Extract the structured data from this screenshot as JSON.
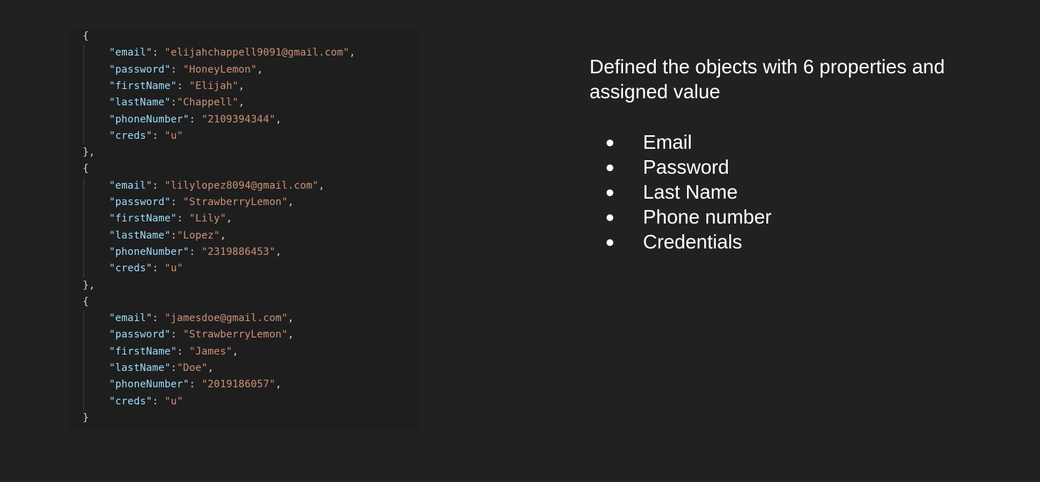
{
  "code": {
    "objects": [
      {
        "fields": [
          {
            "key": "\"email\"",
            "sep": ": ",
            "value": "\"elijahchappell9091@gmail.com\"",
            "trail": ","
          },
          {
            "key": "\"password\"",
            "sep": ": ",
            "value": "\"HoneyLemon\"",
            "trail": ","
          },
          {
            "key": "\"firstName\"",
            "sep": ": ",
            "value": "\"Elijah\"",
            "trail": ","
          },
          {
            "key": "\"lastName\"",
            "sep": ":",
            "value": "\"Chappell\"",
            "trail": ","
          },
          {
            "key": "\"phoneNumber\"",
            "sep": ": ",
            "value": "\"2109394344\"",
            "trail": ","
          },
          {
            "key": "\"creds\"",
            "sep": ": ",
            "value": "\"u\"",
            "trail": ""
          }
        ],
        "close": "},"
      },
      {
        "fields": [
          {
            "key": "\"email\"",
            "sep": ": ",
            "value": "\"lilylopez8094@gmail.com\"",
            "trail": ","
          },
          {
            "key": "\"password\"",
            "sep": ": ",
            "value": "\"StrawberryLemon\"",
            "trail": ","
          },
          {
            "key": "\"firstName\"",
            "sep": ": ",
            "value": "\"Lily\"",
            "trail": ","
          },
          {
            "key": "\"lastName\"",
            "sep": ":",
            "value": "\"Lopez\"",
            "trail": ","
          },
          {
            "key": "\"phoneNumber\"",
            "sep": ": ",
            "value": "\"2319886453\"",
            "trail": ","
          },
          {
            "key": "\"creds\"",
            "sep": ": ",
            "value": "\"u\"",
            "trail": ""
          }
        ],
        "close": "},"
      },
      {
        "fields": [
          {
            "key": "\"email\"",
            "sep": ": ",
            "value": "\"jamesdoe@gmail.com\"",
            "trail": ","
          },
          {
            "key": "\"password\"",
            "sep": ": ",
            "value": "\"StrawberryLemon\"",
            "trail": ","
          },
          {
            "key": "\"firstName\"",
            "sep": ": ",
            "value": "\"James\"",
            "trail": ","
          },
          {
            "key": "\"lastName\"",
            "sep": ":",
            "value": "\"Doe\"",
            "trail": ","
          },
          {
            "key": "\"phoneNumber\"",
            "sep": ": ",
            "value": "\"2019186057\"",
            "trail": ","
          },
          {
            "key": "\"creds\"",
            "sep": ": ",
            "value": "\"u\"",
            "trail": ""
          }
        ],
        "close": "}"
      }
    ],
    "open": "{",
    "colors": {
      "background": "#1e1e1e",
      "key": "#9cdcfe",
      "string": "#ce9178",
      "punctuation": "#d4d4d4"
    }
  },
  "description": {
    "text": "Defined the objects with 6 properties and assigned value",
    "bullet_char": "●",
    "items": [
      "Email",
      "Password",
      "Last Name",
      "Phone number",
      "Credentials"
    ]
  }
}
